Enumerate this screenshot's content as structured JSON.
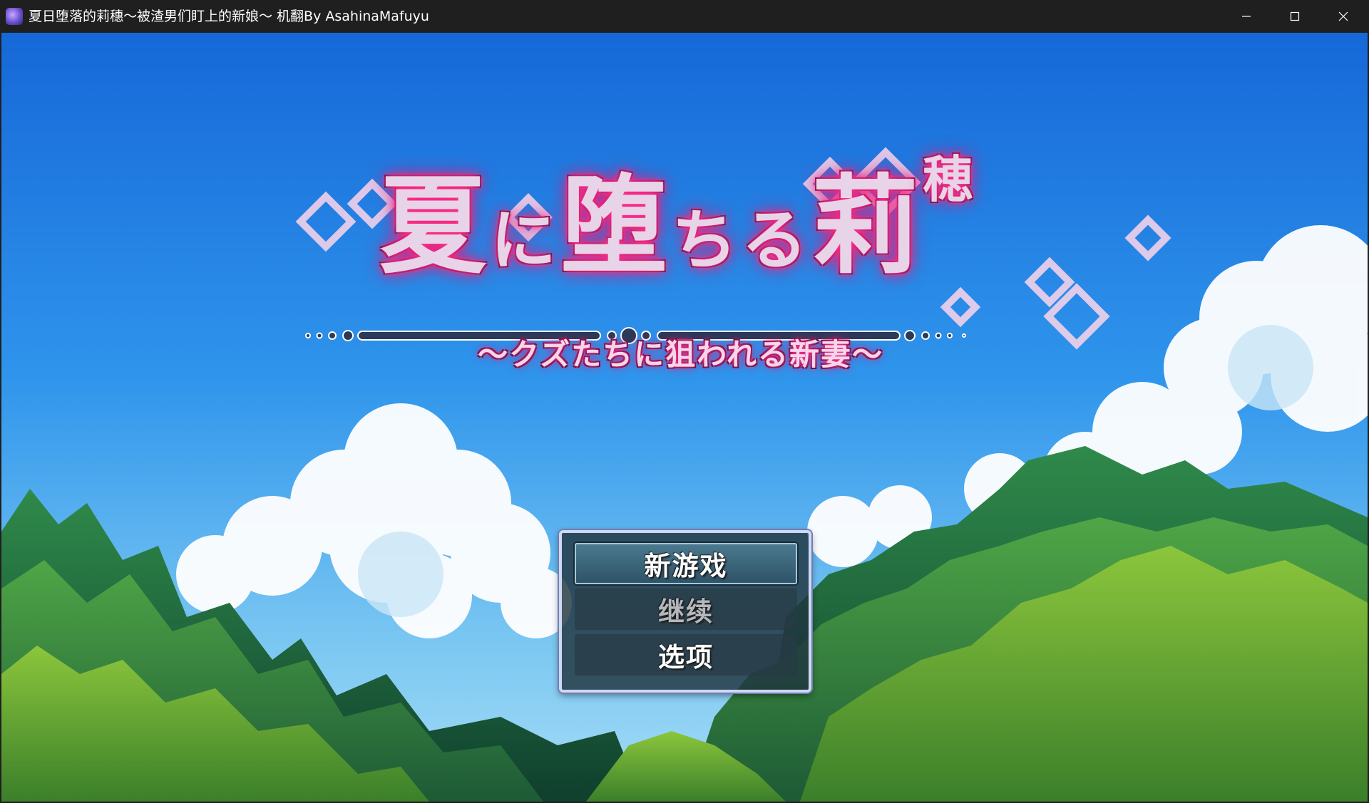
{
  "window": {
    "title": "夏日堕落的莉穗～被渣男们盯上的新娘～ 机翻By AsahinaMafuyu",
    "controls": {
      "minimize_icon": "minimize-icon",
      "maximize_icon": "maximize-icon",
      "close_icon": "close-icon"
    }
  },
  "logo": {
    "title_parts": [
      "夏",
      "に",
      "堕",
      "ち",
      "る",
      "莉",
      "穂"
    ],
    "subtitle": "～クズたちに狙われる新妻～"
  },
  "menu": {
    "items": [
      {
        "label": "新游戏",
        "state": "selected"
      },
      {
        "label": "继续",
        "state": "disabled"
      },
      {
        "label": "选项",
        "state": "normal"
      }
    ]
  },
  "colors": {
    "sky_top": "#1668d8",
    "sky_bottom": "#7cc8f2",
    "logo_glow": "#ff2f8a",
    "menu_border": "#cfd8f4"
  }
}
